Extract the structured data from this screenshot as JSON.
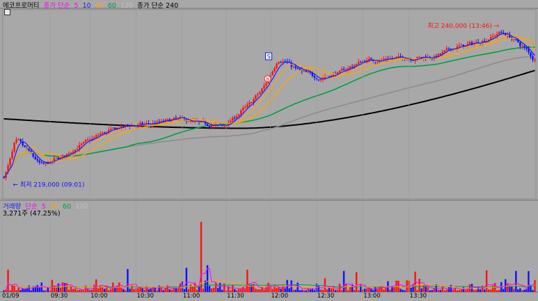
{
  "price_legend": {
    "stock_name": "에코프로머티",
    "ma_label": "종가 단순",
    "periods": [
      "5",
      "10",
      "20",
      "60",
      "120"
    ],
    "long_ma_label": "종가 단순 240"
  },
  "volume_legend": {
    "volume_label": "거래량",
    "ma_label": "단순",
    "periods": [
      "5",
      "20",
      "60",
      "120"
    ],
    "current": "3,271주 (47.25%)"
  },
  "colors": {
    "background": "#a8a8a8",
    "up": "#ff1010",
    "down": "#1010ff",
    "ma5": "#1a1aff",
    "ma10": "#ffa500",
    "ma20": "#00a040",
    "ma60": "#808080",
    "ma120": "#808080",
    "ma240": "#000000"
  },
  "chart_data": [
    {
      "type": "candlestick",
      "title": "에코프로머티",
      "x_ticks": [
        "01/09",
        "09:30",
        "10:00",
        "10:30",
        "11:00",
        "11:30",
        "12:00",
        "12:30",
        "13:00",
        "13:30"
      ],
      "ylim": [
        216000,
        242000
      ],
      "annotations": {
        "high": "최고 240,000 (13:46)",
        "low": "최저 219,000 (09:01)",
        "signal_up": "S",
        "signal_down": "B"
      },
      "price_path": [
        [
          0,
          219000
        ],
        [
          5,
          224500
        ],
        [
          9,
          223000
        ],
        [
          17,
          220500
        ],
        [
          28,
          222000
        ],
        [
          36,
          223500
        ],
        [
          46,
          225000
        ],
        [
          56,
          226000
        ],
        [
          68,
          226200
        ],
        [
          82,
          227000
        ],
        [
          92,
          226400
        ],
        [
          104,
          226000
        ],
        [
          116,
          229000
        ],
        [
          124,
          231700
        ],
        [
          130,
          235500
        ],
        [
          140,
          233500
        ],
        [
          150,
          232500
        ],
        [
          160,
          233500
        ],
        [
          170,
          235000
        ],
        [
          180,
          235200
        ],
        [
          192,
          235400
        ],
        [
          204,
          235500
        ],
        [
          214,
          236800
        ],
        [
          222,
          237300
        ],
        [
          230,
          238000
        ],
        [
          236,
          239000
        ],
        [
          240,
          238300
        ],
        [
          248,
          236500
        ],
        [
          252,
          235000
        ]
      ],
      "volume_spikes": [
        [
          2,
          3500
        ],
        [
          59,
          3600
        ],
        [
          87,
          3800
        ],
        [
          94,
          11000
        ],
        [
          97,
          4200
        ],
        [
          116,
          3500
        ],
        [
          162,
          3300
        ],
        [
          168,
          3100
        ],
        [
          196,
          3200
        ],
        [
          230,
          3400
        ],
        [
          244,
          3300
        ],
        [
          250,
          3271
        ]
      ],
      "volume_ylim": [
        0,
        12000
      ]
    }
  ]
}
